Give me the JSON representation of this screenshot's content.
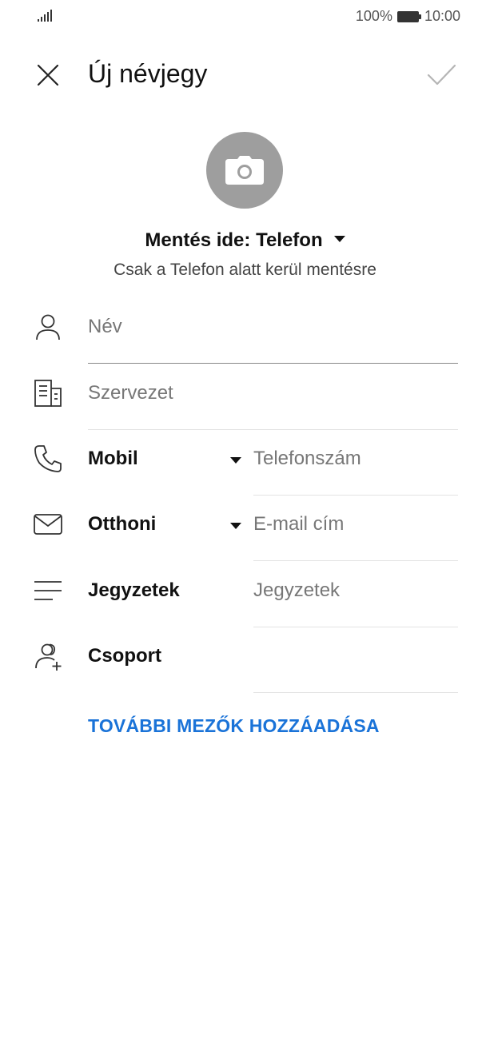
{
  "status": {
    "battery": "100%",
    "time": "10:00"
  },
  "header": {
    "title": "Új névjegy"
  },
  "save": {
    "label": "Mentés ide: Telefon",
    "hint": "Csak a Telefon alatt kerül mentésre"
  },
  "fields": {
    "name_placeholder": "Név",
    "org_placeholder": "Szervezet",
    "phone_type": "Mobil",
    "phone_placeholder": "Telefonszám",
    "email_type": "Otthoni",
    "email_placeholder": "E-mail cím",
    "notes_label": "Jegyzetek",
    "notes_placeholder": "Jegyzetek",
    "group_label": "Csoport"
  },
  "actions": {
    "add_more": "TOVÁBBI MEZŐK HOZZÁADÁSA"
  },
  "colors": {
    "accent": "#1a73d8",
    "photo_bg": "#9e9e9e"
  }
}
